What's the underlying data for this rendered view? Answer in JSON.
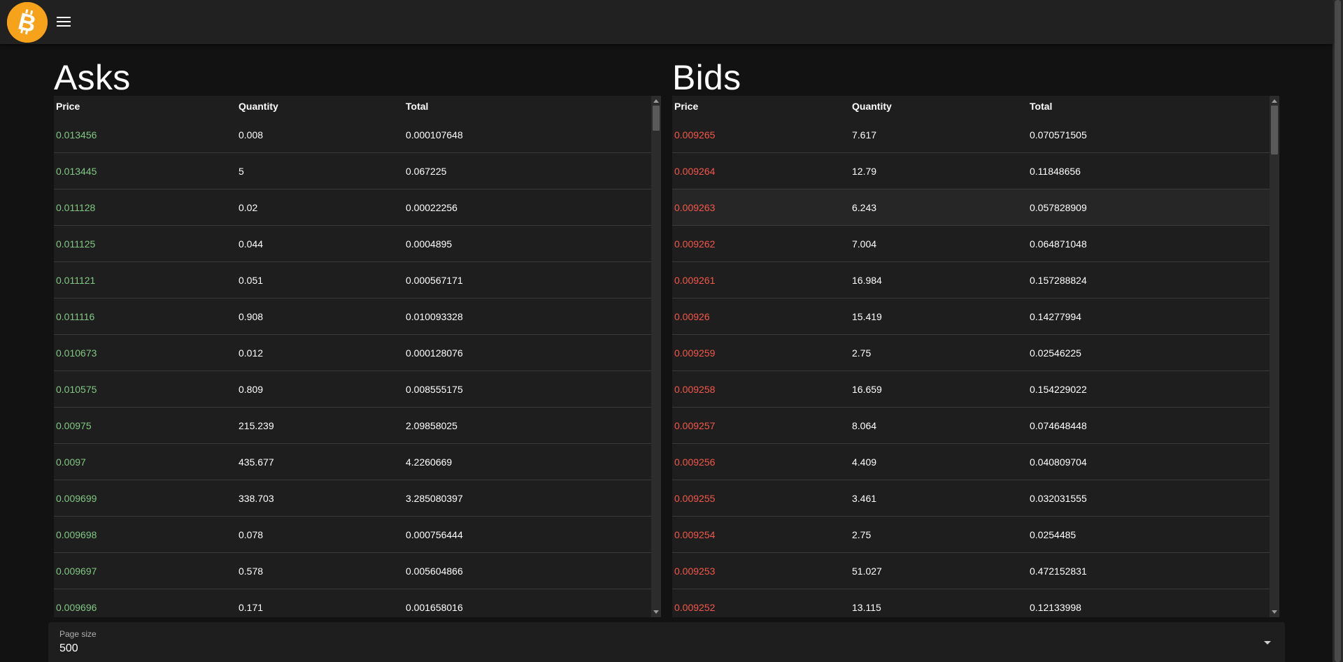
{
  "app": {
    "logo_icon": "bitcoin-logo-icon",
    "menu_icon": "hamburger-menu-icon",
    "brand_color": "#f7a21b"
  },
  "asks": {
    "title": "Asks",
    "headers": [
      "Price",
      "Quantity",
      "Total"
    ],
    "rows": [
      [
        "0.013456",
        "0.008",
        "0.000107648"
      ],
      [
        "0.013445",
        "5",
        "0.067225"
      ],
      [
        "0.011128",
        "0.02",
        "0.00022256"
      ],
      [
        "0.011125",
        "0.044",
        "0.0004895"
      ],
      [
        "0.011121",
        "0.051",
        "0.000567171"
      ],
      [
        "0.011116",
        "0.908",
        "0.010093328"
      ],
      [
        "0.010673",
        "0.012",
        "0.000128076"
      ],
      [
        "0.010575",
        "0.809",
        "0.008555175"
      ],
      [
        "0.00975",
        "215.239",
        "2.09858025"
      ],
      [
        "0.0097",
        "435.677",
        "4.2260669"
      ],
      [
        "0.009699",
        "338.703",
        "3.285080397"
      ],
      [
        "0.009698",
        "0.078",
        "0.000756444"
      ],
      [
        "0.009697",
        "0.578",
        "0.005604866"
      ],
      [
        "0.009696",
        "0.171",
        "0.001658016"
      ]
    ],
    "price_color": "#81c784"
  },
  "bids": {
    "title": "Bids",
    "headers": [
      "Price",
      "Quantity",
      "Total"
    ],
    "rows": [
      [
        "0.009265",
        "7.617",
        "0.070571505"
      ],
      [
        "0.009264",
        "12.79",
        "0.11848656"
      ],
      [
        "0.009263",
        "6.243",
        "0.057828909"
      ],
      [
        "0.009262",
        "7.004",
        "0.064871048"
      ],
      [
        "0.009261",
        "16.984",
        "0.157288824"
      ],
      [
        "0.00926",
        "15.419",
        "0.14277994"
      ],
      [
        "0.009259",
        "2.75",
        "0.02546225"
      ],
      [
        "0.009258",
        "16.659",
        "0.154229022"
      ],
      [
        "0.009257",
        "8.064",
        "0.074648448"
      ],
      [
        "0.009256",
        "4.409",
        "0.040809704"
      ],
      [
        "0.009255",
        "3.461",
        "0.032031555"
      ],
      [
        "0.009254",
        "2.75",
        "0.0254485"
      ],
      [
        "0.009253",
        "51.027",
        "0.472152831"
      ],
      [
        "0.009252",
        "13.115",
        "0.12133998"
      ]
    ],
    "price_color": "#f4574a",
    "hovered_row": 2
  },
  "page_size": {
    "label": "Page size",
    "value": "500",
    "dropdown_icon": "caret-down-icon"
  }
}
